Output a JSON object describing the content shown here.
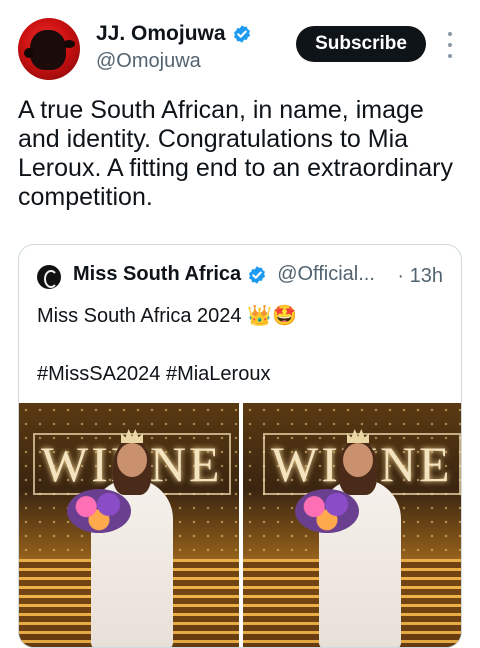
{
  "tweet": {
    "author": {
      "display_name": "JJ. Omojuwa",
      "handle": "@Omojuwa",
      "verified_icon": "verified-badge-icon"
    },
    "subscribe_label": "Subscribe",
    "more_icon": "more-vertical-icon",
    "text": "A true South African, in name, image and identity. Congratulations to Mia Leroux. A fitting end to an extraordinary competition."
  },
  "quote": {
    "author": {
      "display_name": "Miss South Africa",
      "handle": "@Official...",
      "separator": "·",
      "time": "13h"
    },
    "text": "Miss South Africa 2024 👑🤩",
    "hashtags": "#MissSA2024 #MiaLeroux",
    "photos": [
      {
        "sign_text": "WINNE"
      },
      {
        "sign_text": "WINNE"
      }
    ]
  },
  "colors": {
    "accent": "#1d9bf0",
    "text": "#0f1419",
    "muted": "#536471",
    "border": "#cfd9de"
  }
}
